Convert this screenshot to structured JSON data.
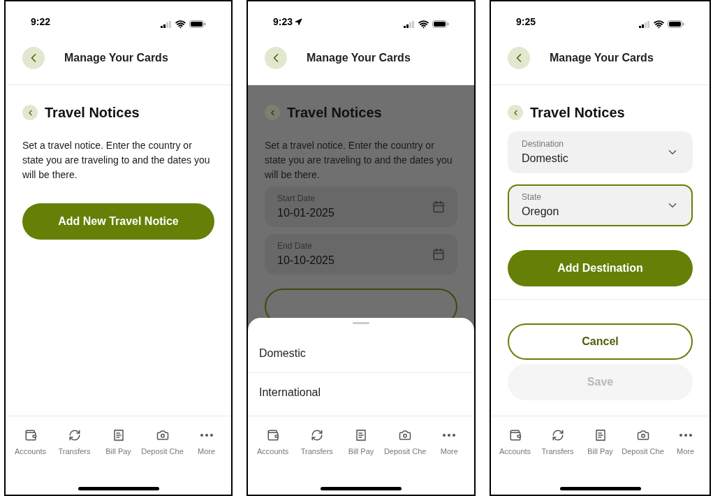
{
  "screens": [
    {
      "time": "9:22",
      "location_arrow": false,
      "header": "Manage Your Cards",
      "section": "Travel Notices",
      "description": "Set a travel notice. Enter the country or state you are traveling to and the dates you will be there.",
      "dimmed": false,
      "content": [
        {
          "kind": "primary_button",
          "label": "Add New Travel Notice"
        }
      ],
      "tabs": [
        "Accounts",
        "Transfers",
        "Bill Pay",
        "Deposit Che",
        "More"
      ]
    },
    {
      "time": "9:23",
      "location_arrow": true,
      "header": "Manage Your Cards",
      "section": "Travel Notices",
      "description": "Set a travel notice. Enter the country or state you are traveling to and the dates you will be there.",
      "dimmed": true,
      "content": [
        {
          "kind": "date_field",
          "label": "Start Date",
          "value": "10-01-2025"
        },
        {
          "kind": "date_field",
          "label": "End Date",
          "value": "10-10-2025"
        },
        {
          "kind": "outline_button"
        }
      ],
      "sheet": {
        "options": [
          "Domestic",
          "International"
        ]
      },
      "tabs": [
        "Accounts",
        "Transfers",
        "Bill Pay",
        "Deposit Che",
        "More"
      ]
    },
    {
      "time": "9:25",
      "location_arrow": false,
      "header": "Manage Your Cards",
      "section": "Travel Notices",
      "dimmed": false,
      "content": [
        {
          "kind": "select_field",
          "label": "Destination",
          "value": "Domestic",
          "focused": false
        },
        {
          "kind": "select_field",
          "label": "State",
          "value": "Oregon",
          "focused": true
        },
        {
          "kind": "primary_button",
          "label": "Add Destination"
        },
        {
          "kind": "divider"
        },
        {
          "kind": "outline_button",
          "label": "Cancel"
        },
        {
          "kind": "disabled_button",
          "label": "Save"
        }
      ],
      "tabs": [
        "Accounts",
        "Transfers",
        "Bill Pay",
        "Deposit Che",
        "More"
      ]
    }
  ]
}
